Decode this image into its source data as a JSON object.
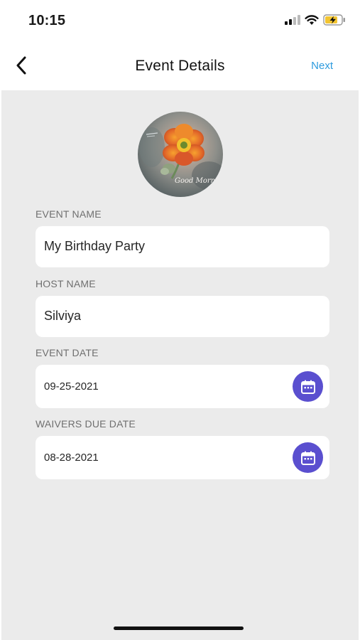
{
  "status_bar": {
    "time": "10:15",
    "icons": [
      "cellular-signal-icon",
      "wifi-icon",
      "battery-charging-icon"
    ]
  },
  "nav": {
    "back_icon": "chevron-left-icon",
    "title": "Event Details",
    "next_label": "Next"
  },
  "event_image": {
    "overlay_text": "Good Morning"
  },
  "fields": {
    "event_name": {
      "label": "EVENT NAME",
      "value": "My Birthday Party"
    },
    "host_name": {
      "label": "HOST NAME",
      "value": "Silviya"
    },
    "event_date": {
      "label": "EVENT DATE",
      "value": "09-25-2021",
      "icon": "calendar-icon"
    },
    "waivers_due_date": {
      "label": "WAIVERS DUE DATE",
      "value": "08-28-2021",
      "icon": "calendar-icon"
    }
  },
  "colors": {
    "accent": "#2d9bde",
    "calendar_button": "#5a4fcf",
    "background": "#ebebeb"
  }
}
